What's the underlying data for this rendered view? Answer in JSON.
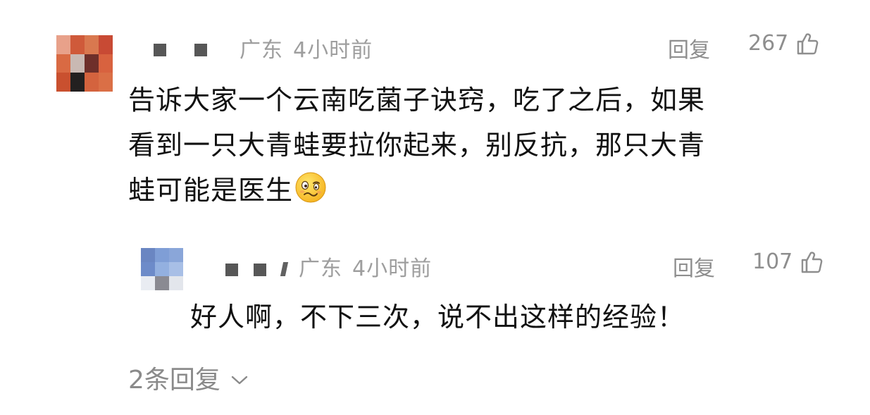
{
  "comment": {
    "location": "广东",
    "time": "4小时前",
    "reply_label": "回复",
    "like_count": "267",
    "text_line1": "告诉大家一个云南吃菌子诀窍，吃了之后，如果",
    "text_line2": "看到一只大青蛙要拉你起来，别反抗，那只大青",
    "text_line3": "蛙可能是医生",
    "emoji": "woozy-face",
    "avatar_colors": [
      "#e8a18a",
      "#cf5a3a",
      "#d9784f",
      "#c84a34",
      "#d96a43",
      "#c9b9b3",
      "#6e2f2a",
      "#d8623f",
      "#c9502f",
      "#232020",
      "#d4633e",
      "#da6f46"
    ]
  },
  "reply": {
    "location": "广东",
    "time": "4小时前",
    "reply_label": "回复",
    "like_count": "107",
    "text": "好人啊，不下三次，说不出这样的经验！",
    "avatar_colors": [
      "#6a86c2",
      "#7f9ed6",
      "#8aa6d9",
      "#6d8bc9",
      "#93b0e0",
      "#a8bfe6",
      "#e9ecf2",
      "#8a8a92",
      "#e3e6ec"
    ]
  },
  "more_replies": {
    "label": "2条回复",
    "icon": "chevron-down-icon"
  }
}
